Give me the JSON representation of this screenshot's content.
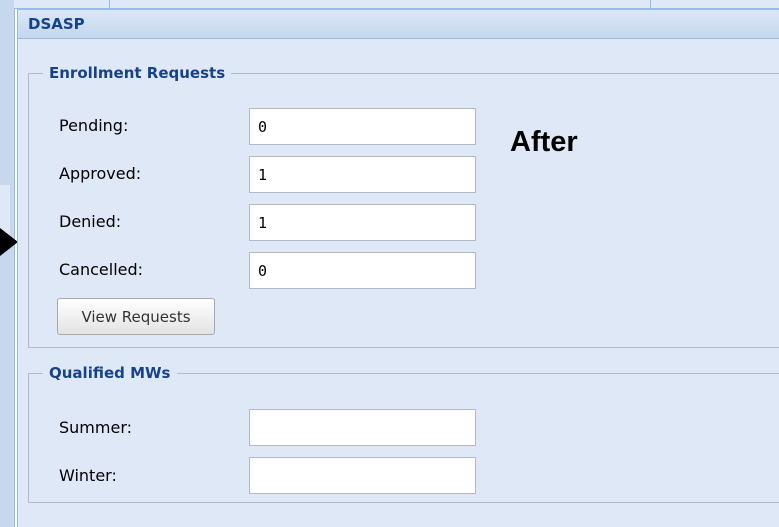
{
  "panel": {
    "title": "DSASP"
  },
  "enrollment": {
    "legend": "Enrollment Requests",
    "rows": [
      {
        "label": "Pending:",
        "value": "0"
      },
      {
        "label": "Approved:",
        "value": "1"
      },
      {
        "label": "Denied:",
        "value": "1"
      },
      {
        "label": "Cancelled:",
        "value": "0"
      }
    ],
    "button_label": "View Requests"
  },
  "qualified": {
    "legend": "Qualified MWs",
    "rows": [
      {
        "label": "Summer:",
        "value": ""
      },
      {
        "label": "Winter:",
        "value": ""
      }
    ]
  },
  "annotation": {
    "text": "After"
  },
  "colors": {
    "panel_bg": "#dfe8f6",
    "header_text": "#15428b",
    "border": "#99bbe8"
  }
}
